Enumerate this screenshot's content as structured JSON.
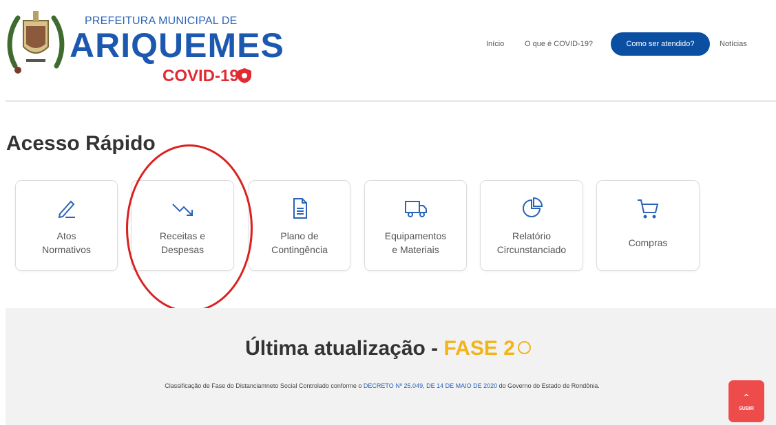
{
  "header": {
    "logo_top": "PREFEITURA MUNICIPAL DE",
    "logo_main": "ARIQUEMES",
    "logo_sub": "COVID-19",
    "nav": {
      "home": "Início",
      "what": "O que é COVID-19?",
      "button": "Como ser atendido?",
      "news": "Notícias"
    }
  },
  "quick_access": {
    "title": "Acesso Rápido",
    "cards": [
      {
        "label": "Atos\nNormativos",
        "icon": "pencil-icon"
      },
      {
        "label": "Receitas e\nDespesas",
        "icon": "trend-down-icon"
      },
      {
        "label": "Plano de\nContingência",
        "icon": "document-icon"
      },
      {
        "label": "Equipamentos\ne Materiais",
        "icon": "truck-icon"
      },
      {
        "label": "Relatório\nCircunstanciado",
        "icon": "pie-chart-icon"
      },
      {
        "label": "Compras",
        "icon": "cart-icon"
      }
    ]
  },
  "update": {
    "title_prefix": "Última atualização - ",
    "phase": "FASE 2",
    "note_before": "Classificação de Fase do Distanciamneto Social Controlado conforme o ",
    "note_link": "DECRETO Nº 25.049, DE 14 DE MAIO DE 2020",
    "note_after": " do Governo do Estado de Rondônia."
  },
  "scroll_up": {
    "label": "SUBIR"
  },
  "colors": {
    "brand_blue": "#1d58b0",
    "brand_red": "#e02b33",
    "nav_button": "#0b4fa3",
    "phase_yellow": "#f2b418",
    "annotation_red": "#d9221f",
    "scroll_button": "#ee4b4b"
  }
}
